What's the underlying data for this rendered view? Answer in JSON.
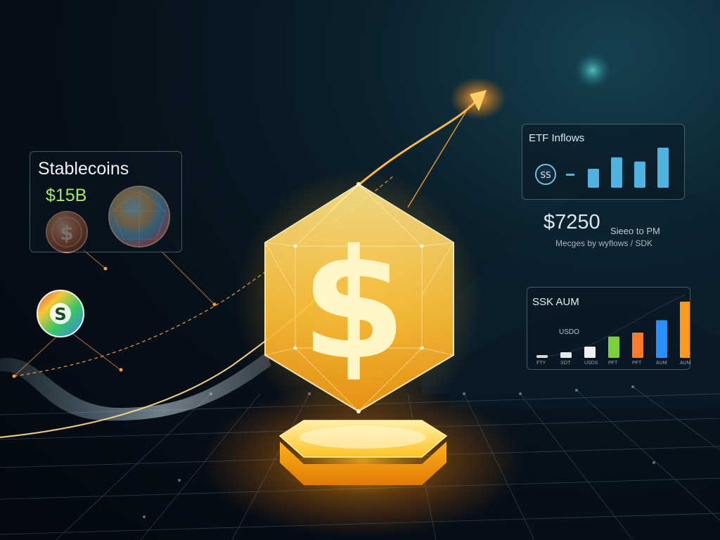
{
  "stablecoins_panel": {
    "title": "Stablecoins",
    "value": "$15B"
  },
  "central_symbol": "$",
  "coin_symbols": {
    "bronze": "$",
    "multicolor": "S"
  },
  "etf_panel": {
    "title": "ETF Inflows",
    "badge_text": "SS",
    "bars": [
      0.45,
      0.72,
      0.62,
      0.95
    ]
  },
  "value_text": "$7250",
  "caption": {
    "line1": "Sieeo to PM",
    "line2": "Mecges by wyflows / SDK"
  },
  "aum_panel": {
    "title": "SSK AUM",
    "series_label": "USDO",
    "x_labels": [
      "FTY",
      "SOT",
      "USDS",
      "PFT",
      "PFT",
      "AUM",
      "AUM"
    ],
    "bars": [
      {
        "value": 0.05,
        "color": "#d8d8d8"
      },
      {
        "value": 0.1,
        "color": "#e8e8e8"
      },
      {
        "value": 0.2,
        "color": "#f0f0f0"
      },
      {
        "value": 0.38,
        "color": "#7ccf3c"
      },
      {
        "value": 0.45,
        "color": "#ff7a2a"
      },
      {
        "value": 0.67,
        "color": "#2a90ff"
      },
      {
        "value": 1.0,
        "color": "#ff9a1f"
      }
    ]
  },
  "colors": {
    "accent": "#ffc33a",
    "bar_blue": "#4fb3e0"
  }
}
